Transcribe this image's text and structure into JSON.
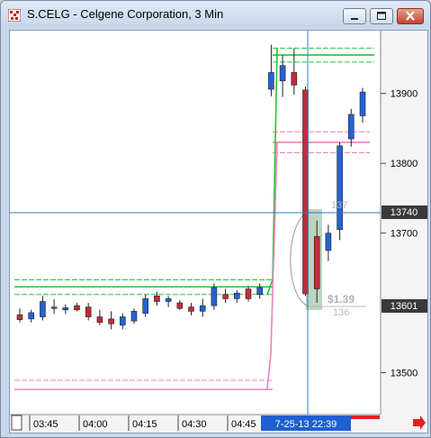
{
  "window": {
    "title": "S.CELG - Celgene Corporation, 3 Min",
    "controls": {
      "minimize": "minimize",
      "maximize": "maximize",
      "close": "close"
    }
  },
  "colors": {
    "up_candle": "#2463d6",
    "down_candle": "#c42a36",
    "green_lines": "#27c238",
    "pink_lines": "#f07fbf",
    "crosshair": "#2a7fc0",
    "price_tag_bg": "#3a3a3a",
    "time_tag_bg": "#1f5fd1"
  },
  "price_axis": {
    "ticks": [
      "13900",
      "13800",
      "13700",
      "13500"
    ],
    "crosshair_tag": "13740",
    "last_price_tag": "13601"
  },
  "time_axis": {
    "ticks": [
      "03:45",
      "04:00",
      "04:15",
      "04:30",
      "04:45"
    ],
    "crosshair_tag": "7-25-13 22:39"
  },
  "overlay_labels": {
    "upper_count": "137",
    "profit": "$1.39",
    "lower_count": "136"
  },
  "chart_data": {
    "type": "candlestick",
    "timeframe": "3 Min",
    "ylim": [
      13440,
      13990
    ],
    "candles": [
      {
        "o": 13583,
        "h": 13592,
        "l": 13572,
        "c": 13576
      },
      {
        "o": 13577,
        "h": 13590,
        "l": 13572,
        "c": 13586
      },
      {
        "o": 13580,
        "h": 13610,
        "l": 13575,
        "c": 13602
      },
      {
        "o": 13594,
        "h": 13605,
        "l": 13584,
        "c": 13592
      },
      {
        "o": 13590,
        "h": 13598,
        "l": 13584,
        "c": 13593
      },
      {
        "o": 13596,
        "h": 13600,
        "l": 13588,
        "c": 13590
      },
      {
        "o": 13594,
        "h": 13600,
        "l": 13575,
        "c": 13580
      },
      {
        "o": 13580,
        "h": 13590,
        "l": 13568,
        "c": 13572
      },
      {
        "o": 13577,
        "h": 13588,
        "l": 13562,
        "c": 13570
      },
      {
        "o": 13568,
        "h": 13585,
        "l": 13562,
        "c": 13580
      },
      {
        "o": 13574,
        "h": 13592,
        "l": 13570,
        "c": 13588
      },
      {
        "o": 13585,
        "h": 13612,
        "l": 13580,
        "c": 13606
      },
      {
        "o": 13610,
        "h": 13616,
        "l": 13596,
        "c": 13602
      },
      {
        "o": 13602,
        "h": 13610,
        "l": 13594,
        "c": 13606
      },
      {
        "o": 13600,
        "h": 13604,
        "l": 13590,
        "c": 13592
      },
      {
        "o": 13594,
        "h": 13600,
        "l": 13582,
        "c": 13588
      },
      {
        "o": 13588,
        "h": 13606,
        "l": 13580,
        "c": 13596
      },
      {
        "o": 13596,
        "h": 13628,
        "l": 13590,
        "c": 13622
      },
      {
        "o": 13612,
        "h": 13620,
        "l": 13600,
        "c": 13606
      },
      {
        "o": 13606,
        "h": 13618,
        "l": 13600,
        "c": 13614
      },
      {
        "o": 13620,
        "h": 13624,
        "l": 13602,
        "c": 13606
      },
      {
        "o": 13612,
        "h": 13628,
        "l": 13606,
        "c": 13622
      },
      {
        "o": 13906,
        "h": 13970,
        "l": 13896,
        "c": 13930
      },
      {
        "o": 13918,
        "h": 13955,
        "l": 13895,
        "c": 13940
      },
      {
        "o": 13930,
        "h": 13965,
        "l": 13898,
        "c": 13912
      },
      {
        "o": 13905,
        "h": 13910,
        "l": 13610,
        "c": 13613
      },
      {
        "o": 13695,
        "h": 13718,
        "l": 13600,
        "c": 13620
      },
      {
        "o": 13675,
        "h": 13712,
        "l": 13660,
        "c": 13700
      },
      {
        "o": 13705,
        "h": 13830,
        "l": 13690,
        "c": 13825
      },
      {
        "o": 13835,
        "h": 13878,
        "l": 13824,
        "c": 13870
      },
      {
        "o": 13868,
        "h": 13908,
        "l": 13858,
        "c": 13902
      }
    ],
    "levels": {
      "green": [
        13965,
        13955,
        13945,
        13633,
        13623,
        13612
      ],
      "pink": [
        13845,
        13830,
        13815,
        13489,
        13476
      ]
    }
  }
}
